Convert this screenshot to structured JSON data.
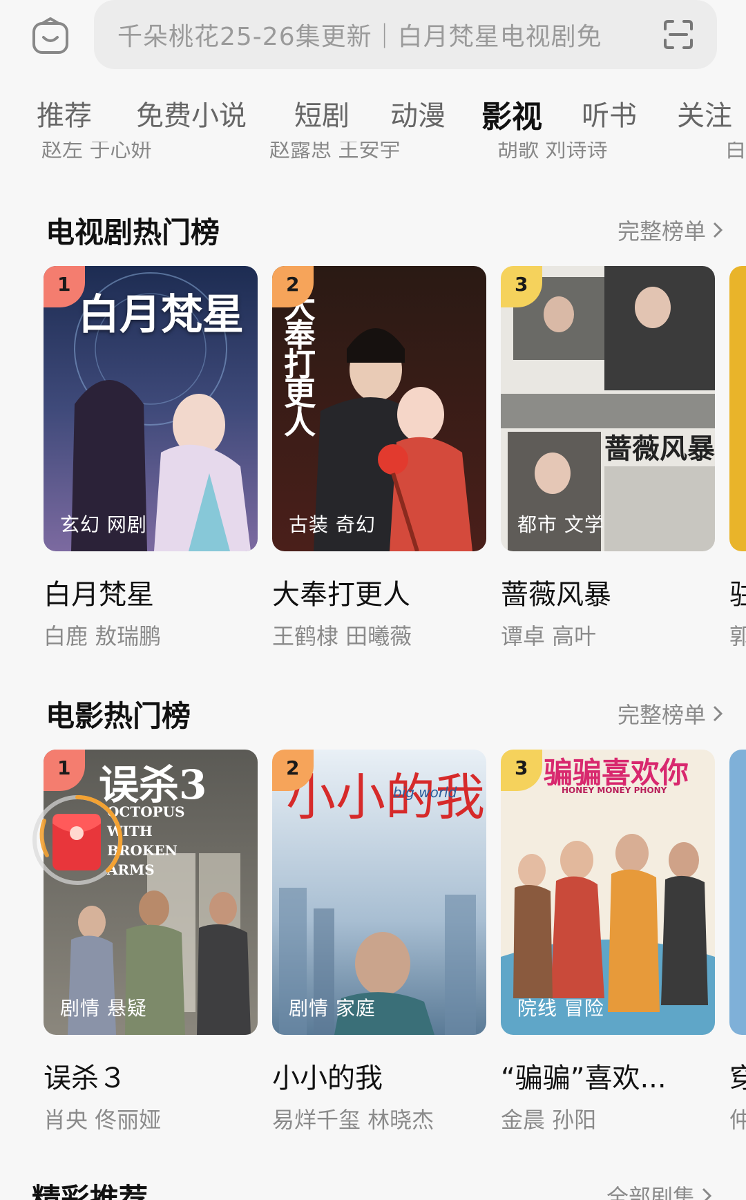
{
  "search": {
    "placeholder_text": "千朵桃花25-26集更新｜白月梵星电视剧免",
    "logo_icon": "home-bag-icon",
    "scan_icon": "scan-icon"
  },
  "tabs": [
    {
      "label": "推荐"
    },
    {
      "label": "免费小说"
    },
    {
      "label": "短剧"
    },
    {
      "label": "动漫"
    },
    {
      "label": "影视",
      "active": true
    },
    {
      "label": "听书"
    },
    {
      "label": "关注"
    }
  ],
  "remnants": [
    "赵左 于心妍",
    "赵露思 王安宇",
    "胡歌 刘诗诗",
    "白"
  ],
  "tv_section": {
    "title": "电视剧热门榜",
    "more_label": "完整榜单",
    "cards": [
      {
        "rank": "1",
        "poster_text": "白月梵星",
        "genre": "玄幻 网剧",
        "title": "白月梵星",
        "cast": "白鹿 敖瑞鹏",
        "rank_color": "#f47d6f"
      },
      {
        "rank": "2",
        "poster_text": "大奉打更人",
        "genre": "古装 奇幻",
        "title": "大奉打更人",
        "cast": "王鹤棣 田曦薇",
        "rank_color": "#f6a45a"
      },
      {
        "rank": "3",
        "poster_text": "蔷薇风暴",
        "genre": "都市 文学",
        "title": "蔷薇风暴",
        "cast": "谭卓 高叶",
        "rank_color": "#f5d25c"
      }
    ],
    "partial": {
      "title": "驻",
      "cast": "郭"
    }
  },
  "movie_section": {
    "title": "电影热门榜",
    "more_label": "完整榜单",
    "cards": [
      {
        "rank": "1",
        "poster_text": "误杀3",
        "poster_subtext": "OCTOPUS WITH BROKEN ARMS",
        "genre": "剧情 悬疑",
        "title": "误杀３",
        "cast": "肖央 佟丽娅",
        "rank_color": "#f47d6f"
      },
      {
        "rank": "2",
        "poster_text": "小小的我",
        "poster_subtext": "big world",
        "genre": "剧情 家庭",
        "title": "小小的我",
        "cast": "易烊千玺 林晓杰",
        "rank_color": "#f6a45a"
      },
      {
        "rank": "3",
        "poster_text": "骗骗喜欢你",
        "poster_subtext": "HONEY MONEY PHONY",
        "genre": "院线 冒险",
        "title": "“骗骗”喜欢...",
        "cast": "金晨 孙阳",
        "rank_color": "#f5d25c"
      }
    ],
    "partial": {
      "title": "穿",
      "cast": "仲"
    }
  },
  "bottom_section": {
    "title": "精彩推荐",
    "more_label": "全部剧集"
  },
  "colors": {
    "bg": "#f7f7f7",
    "search_bg": "#ececec",
    "redpacket": "#e8363b",
    "ring": "#f3a233"
  }
}
